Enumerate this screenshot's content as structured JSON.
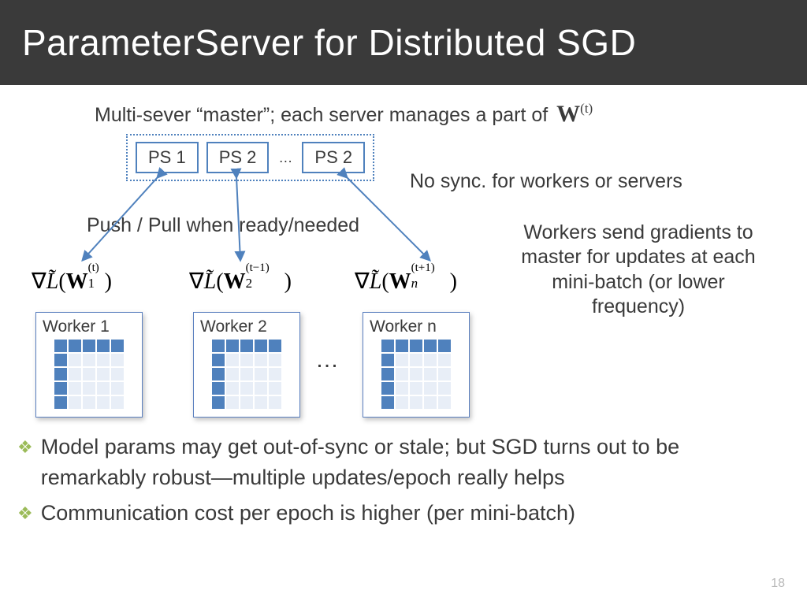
{
  "title": "ParameterServer for Distributed SGD",
  "subtitle_prefix": "Multi-sever “master”; each server manages a part of ",
  "subtitle_math": "W",
  "subtitle_sup": "(t)",
  "ps": {
    "items": [
      "PS 1",
      "PS 2",
      "PS 2"
    ],
    "dots": "…"
  },
  "notes": {
    "nosync": "No sync. for workers or servers",
    "pushpull": "Push / Pull when ready/needed",
    "workers": "Workers send gradients to master for updates at each mini-batch (or lower frequency)"
  },
  "gradients": {
    "g1_sub": "1",
    "g1_sup": "(t)",
    "g2_sub": "2",
    "g2_sup": "(t−1)",
    "g3_sub": "n",
    "g3_sup": "(t+1)"
  },
  "workers": {
    "w1": "Worker 1",
    "w2": "Worker 2",
    "w3": "Worker n",
    "dots": "…"
  },
  "bullets": [
    "Model params may get out-of-sync or stale; but SGD turns out to be remarkably robust—multiple updates/epoch really helps",
    "Communication cost per epoch is higher (per mini-batch)"
  ],
  "pagenum": "18"
}
